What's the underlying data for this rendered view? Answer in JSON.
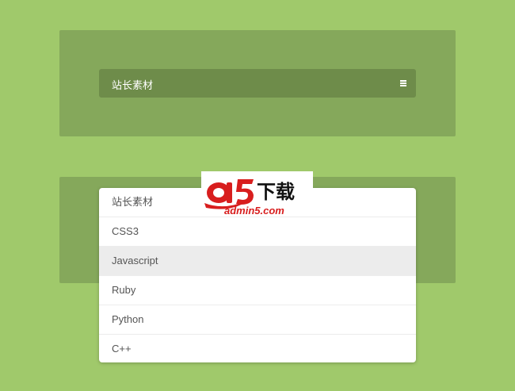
{
  "dropdown": {
    "label": "站长素材",
    "icon": "hamburger-icon"
  },
  "menu": {
    "items": [
      {
        "label": "站长素材"
      },
      {
        "label": "CSS3"
      },
      {
        "label": "Javascript",
        "active": true
      },
      {
        "label": "Ruby"
      },
      {
        "label": "Python"
      },
      {
        "label": "C++"
      }
    ]
  },
  "watermark": {
    "brand": "a5",
    "cn_text": "下载",
    "domain": "admin5.com"
  },
  "colors": {
    "background": "#a0c96b",
    "panel": "#85a85b",
    "dropdown": "#6e8c4a",
    "menu_active": "#ececec",
    "logo_red": "#d81e1e"
  }
}
